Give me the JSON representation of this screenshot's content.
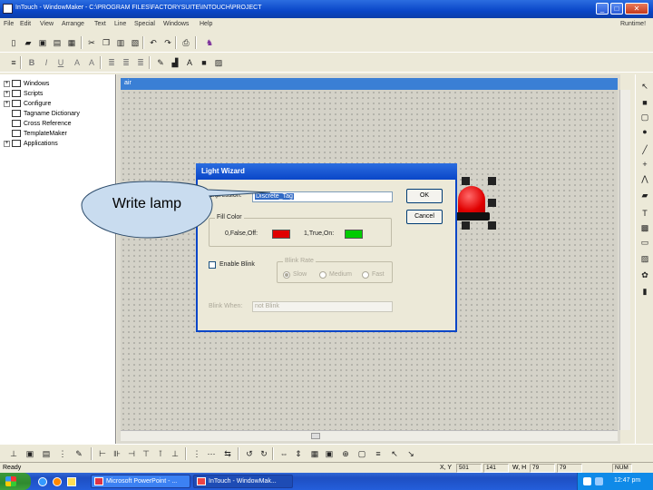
{
  "window": {
    "title": "InTouch - WindowMaker - C:\\PROGRAM FILES\\FACTORYSUITE\\INTOUCH\\PROJECT",
    "runtime_label": "Runtime!"
  },
  "menu": [
    "File",
    "Edit",
    "View",
    "Arrange",
    "Text",
    "Line",
    "Special",
    "Windows",
    "Help"
  ],
  "tree": {
    "items": [
      {
        "label": "Windows",
        "icon": "windows-icon"
      },
      {
        "label": "Scripts",
        "icon": "scripts-icon"
      },
      {
        "label": "Configure",
        "icon": "configure-icon"
      },
      {
        "label": "Tagname Dictionary",
        "icon": "tag-dictionary-icon"
      },
      {
        "label": "Cross Reference",
        "icon": "cross-reference-icon"
      },
      {
        "label": "TemplateMaker",
        "icon": "template-icon"
      },
      {
        "label": "Applications",
        "icon": "applications-icon"
      }
    ]
  },
  "canvas": {
    "window_name": "air"
  },
  "dialog": {
    "title": "Light Wizard",
    "expression_label": "Expression:",
    "expression_value": "Discrete_Tag",
    "ok_label": "OK",
    "cancel_label": "Cancel",
    "fill_color_legend": "Fill Color",
    "false_label": "0,False,Off:",
    "false_color": "#e00000",
    "true_label": "1,True,On:",
    "true_color": "#00cc00",
    "enable_blink_label": "Enable Blink",
    "blink_rate_legend": "Blink Rate",
    "blink_rate_options": [
      "Slow",
      "Medium",
      "Fast"
    ],
    "blink_when_label": "Blink When:",
    "blink_when_value": "not Blink"
  },
  "callout": {
    "text": "Write lamp"
  },
  "status": {
    "ready": "Ready",
    "xy_label": "X, Y",
    "x_value": "501",
    "y_value": "141",
    "wh_label": "W, H",
    "w_value": "79",
    "h_value": "79",
    "num": "NUM"
  },
  "taskbar": {
    "tasks": [
      "Microsoft PowerPoint - ...",
      "InTouch - WindowMak..."
    ],
    "clock": "12:47 pm"
  }
}
